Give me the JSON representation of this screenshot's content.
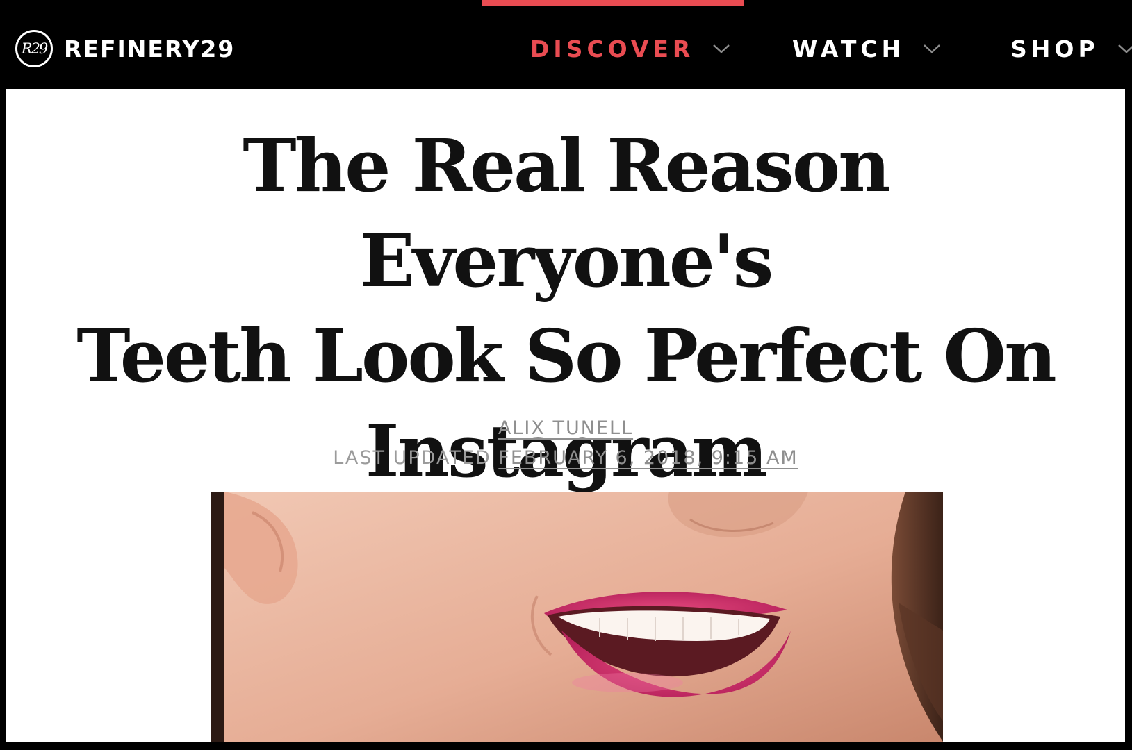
{
  "brand": {
    "logo_mark": "R29",
    "name": "REFINERY29"
  },
  "nav": {
    "items": [
      {
        "label": "DISCOVER",
        "active": true
      },
      {
        "label": "WATCH",
        "active": false
      },
      {
        "label": "SHOP",
        "active": false
      }
    ]
  },
  "article": {
    "headline_lines": [
      "The Real Reason Everyone's",
      "Teeth Look So Perfect On",
      "Instagram"
    ],
    "author": "ALIX TUNELL",
    "updated_prefix": "LAST UPDATED",
    "updated_date": "FEBRUARY 6, 2018, 9:15 AM"
  },
  "colors": {
    "accent": "#e94c52",
    "header_bg": "#000000",
    "meta_text": "#9b9b9b"
  }
}
